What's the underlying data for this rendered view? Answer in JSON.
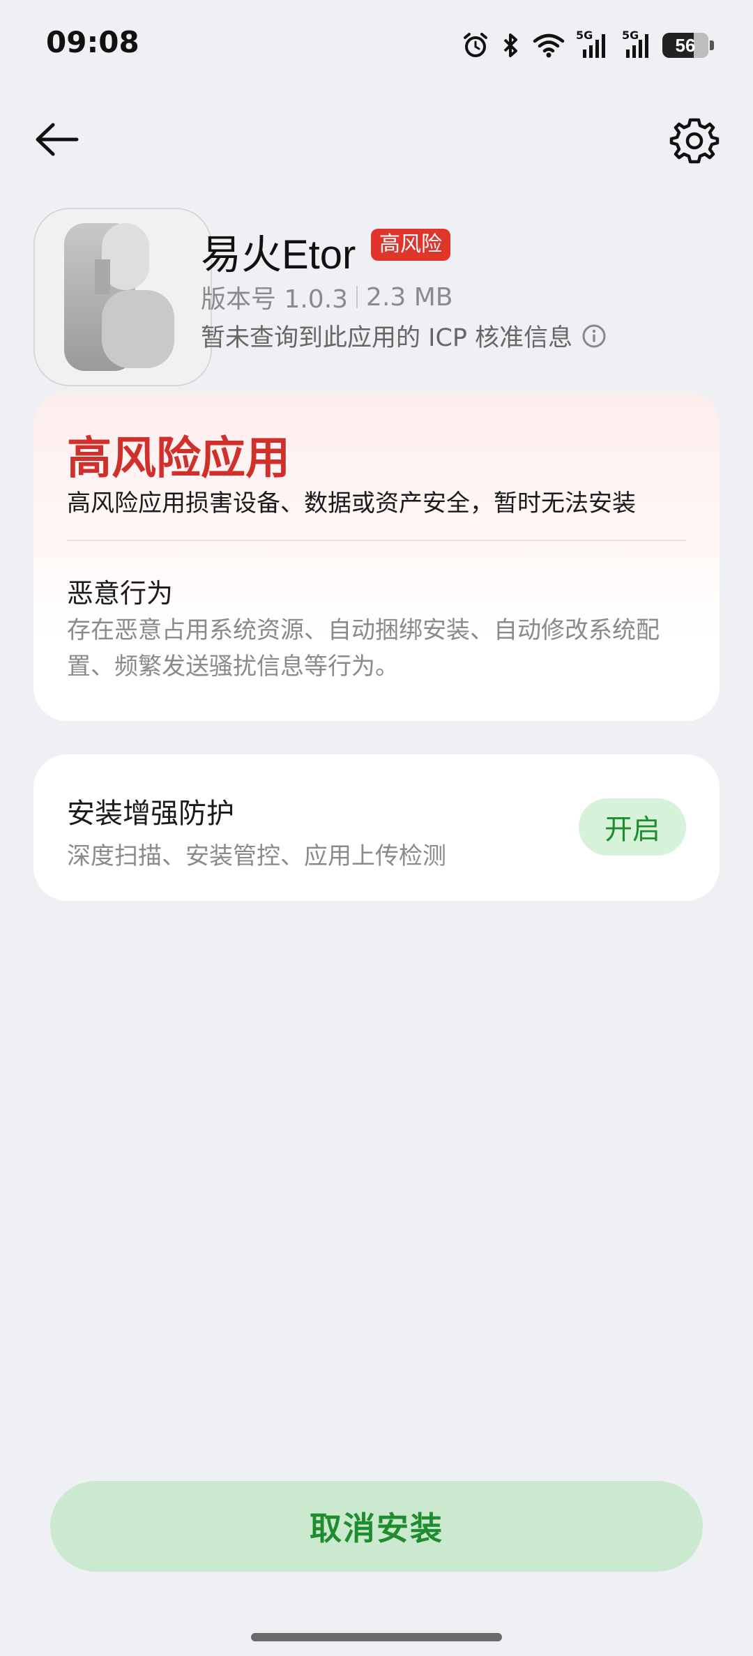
{
  "status_bar": {
    "time": "09:08",
    "signal1_label": "5G",
    "signal2_label": "5G",
    "battery_level": "56"
  },
  "app": {
    "name": "易火Etor",
    "risk_badge": "高风险",
    "version": "版本号 1.0.3",
    "size": "2.3 MB",
    "icp_notice": "暂未查询到此应用的 ICP 核准信息",
    "icon_name": "letter-e-app-icon"
  },
  "warning": {
    "title": "高风险应用",
    "description": "高风险应用损害设备、数据或资产安全，暂时无法安装",
    "behavior_title": "恶意行为",
    "behavior_description": "存在恶意占用系统资源、自动捆绑安装、自动修改系统配置、频繁发送骚扰信息等行为。"
  },
  "protection": {
    "title": "安装增强防护",
    "description": "深度扫描、安装管控、应用上传检测",
    "button_label": "开启"
  },
  "actions": {
    "cancel_label": "取消安装"
  },
  "colors": {
    "accent_green": "#1f8d2f",
    "danger_red": "#d0302b",
    "background": "#eff0f3"
  }
}
